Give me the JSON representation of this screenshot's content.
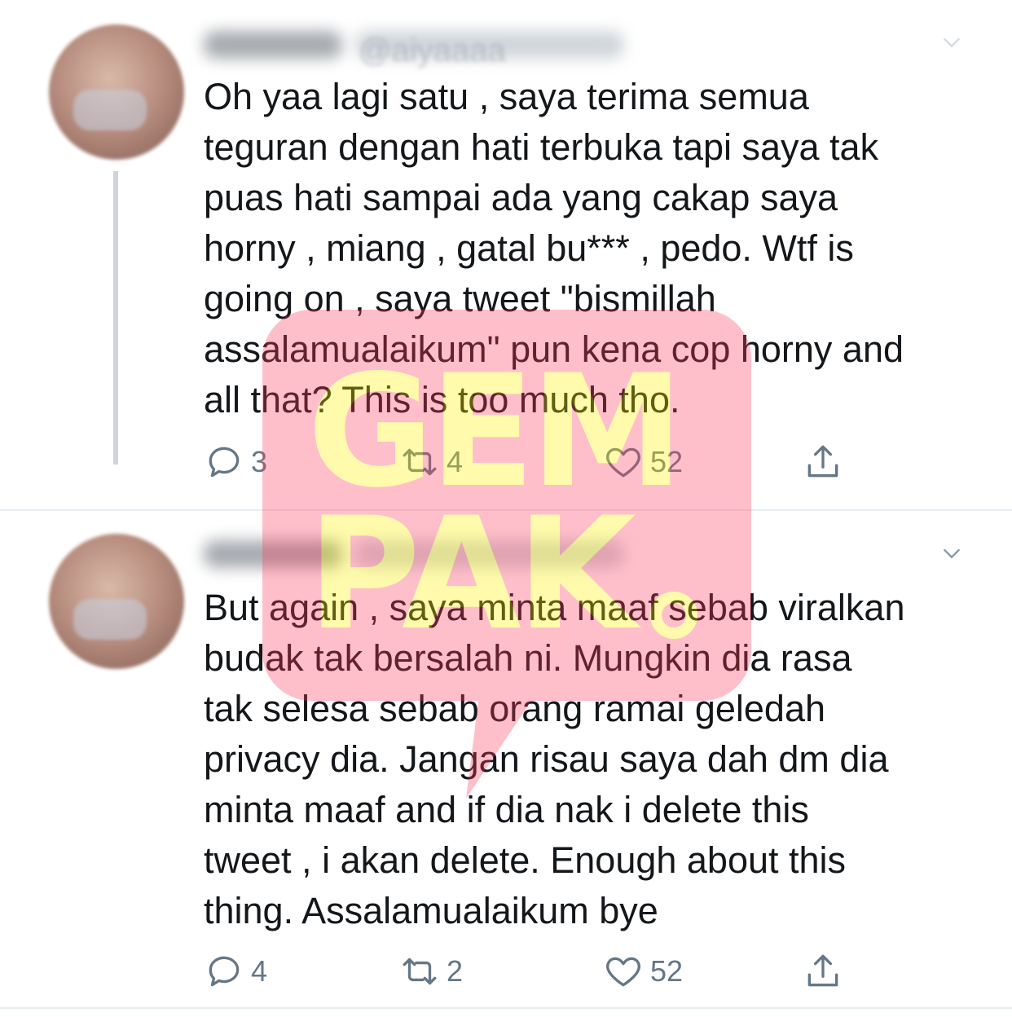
{
  "tweets": [
    {
      "handle_visible": "@aiyaaaa",
      "text": "Oh yaa lagi satu , saya terima semua\nteguran dengan hati terbuka tapi saya tak\npuas hati sampai ada yang cakap saya\nhorny , miang , gatal bu*** , pedo. Wtf is\ngoing on , saya tweet \"bismillah\nassalamualaikum\" pun kena cop horny and\nall that? This is too much tho.",
      "replies": "3",
      "retweets": "4",
      "likes": "52"
    },
    {
      "text": "But again , saya minta maaf sebab viralkan\nbudak tak bersalah ni. Mungkin dia rasa\ntak selesa sebab orang ramai geledah\nprivacy dia. Jangan risau saya dah dm dia\nminta maaf and if dia nak i delete this\ntweet , i akan delete. Enough about this\nthing. Assalamualaikum bye",
      "replies": "4",
      "retweets": "2",
      "likes": "52"
    }
  ],
  "watermark": {
    "line1": "GEM",
    "line2": "PAK",
    "bg_color": "#ff3b5c",
    "text_color": "#fff200"
  },
  "icons": {
    "reply": "reply-icon",
    "retweet": "retweet-icon",
    "like": "heart-icon",
    "share": "share-icon",
    "menu": "chevron-down-icon"
  },
  "colors": {
    "text": "#14171a",
    "secondary": "#657786",
    "thread_line": "#cdd5dc",
    "divider": "#e6ecf0"
  }
}
